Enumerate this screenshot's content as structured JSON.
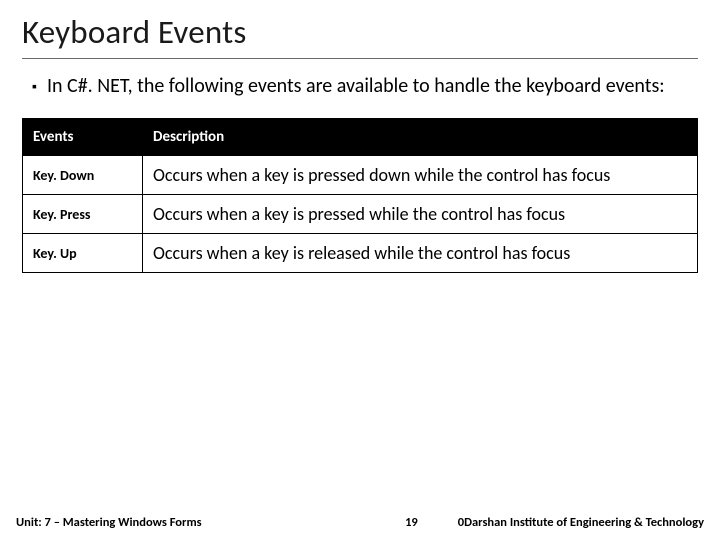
{
  "title": "Keyboard Events",
  "bullet": "In C#. NET, the following events are available to handle the keyboard events:",
  "table": {
    "headers": {
      "events": "Events",
      "description": "Description"
    },
    "rows": [
      {
        "event": "Key. Down",
        "description": "Occurs when a key is pressed down while the control has focus"
      },
      {
        "event": "Key. Press",
        "description": "Occurs when a key is pressed while the control has focus"
      },
      {
        "event": "Key. Up",
        "description": "Occurs when a key is released while the control has focus"
      }
    ]
  },
  "footer": {
    "unit": "Unit: 7 – Mastering Windows Forms",
    "page": "19",
    "institute": "0Darshan Institute of Engineering & Technology"
  }
}
